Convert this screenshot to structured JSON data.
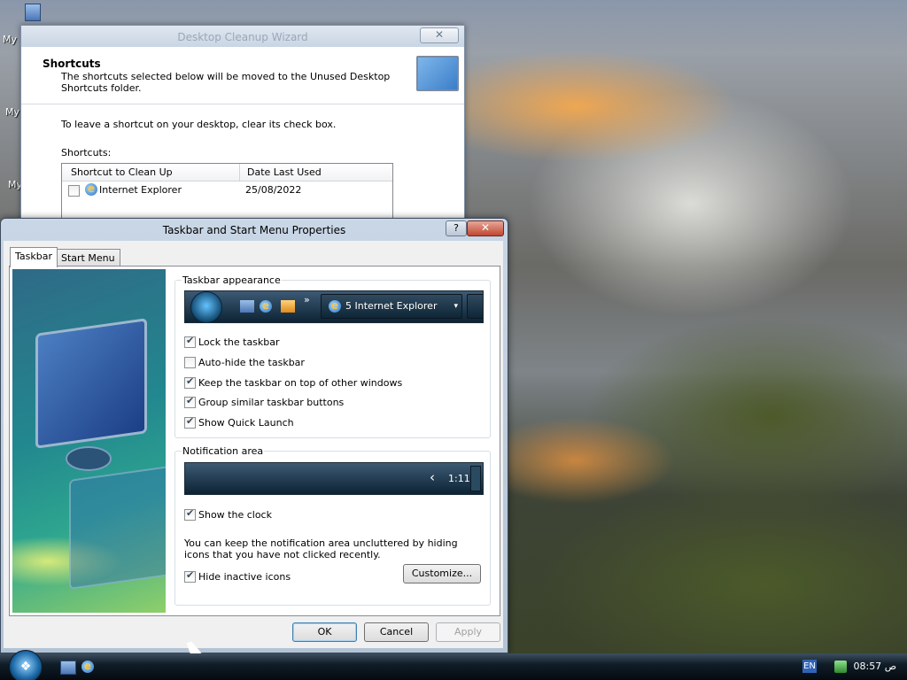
{
  "desktop": {
    "icons": [
      {
        "label": "My"
      },
      {
        "label": "My"
      },
      {
        "label": "My"
      }
    ]
  },
  "wizard": {
    "title": "Desktop Cleanup Wizard",
    "close_glyph": "✕",
    "header_title": "Shortcuts",
    "header_desc": "The shortcuts selected below will be moved to the Unused Desktop Shortcuts folder.",
    "instruction": "To leave a shortcut on your desktop, clear its check box.",
    "list_label": "Shortcuts:",
    "columns": [
      "Shortcut to Clean Up",
      "Date Last Used"
    ],
    "rows": [
      {
        "name": "Internet Explorer",
        "date": "25/08/2022",
        "checked": false
      }
    ]
  },
  "props": {
    "title": "Taskbar and Start Menu Properties",
    "help_glyph": "?",
    "close_glyph": "✕",
    "tabs": [
      "Taskbar",
      "Start Menu"
    ],
    "taskbar_group": {
      "label": "Taskbar appearance",
      "preview_button": "5 Internet Explorer",
      "options": [
        {
          "label": "Lock the taskbar",
          "checked": true
        },
        {
          "label": "Auto-hide the taskbar",
          "checked": false
        },
        {
          "label": "Keep the taskbar on top of other windows",
          "checked": true
        },
        {
          "label": "Group similar taskbar buttons",
          "checked": true
        },
        {
          "label": "Show Quick Launch",
          "checked": true
        }
      ]
    },
    "notification_group": {
      "label": "Notification area",
      "preview_time": "1:11",
      "preview_arrow": "‹",
      "show_clock": {
        "label": "Show the clock",
        "checked": true
      },
      "note": "You can keep the notification area uncluttered by hiding icons that you have not clicked recently.",
      "hide_inactive": {
        "label": "Hide inactive icons",
        "checked": true
      },
      "customize": "Customize..."
    },
    "buttons": {
      "ok": "OK",
      "cancel": "Cancel",
      "apply": "Apply"
    }
  },
  "taskbar": {
    "lang": "EN",
    "time": "08:57",
    "ampm": "ص"
  }
}
